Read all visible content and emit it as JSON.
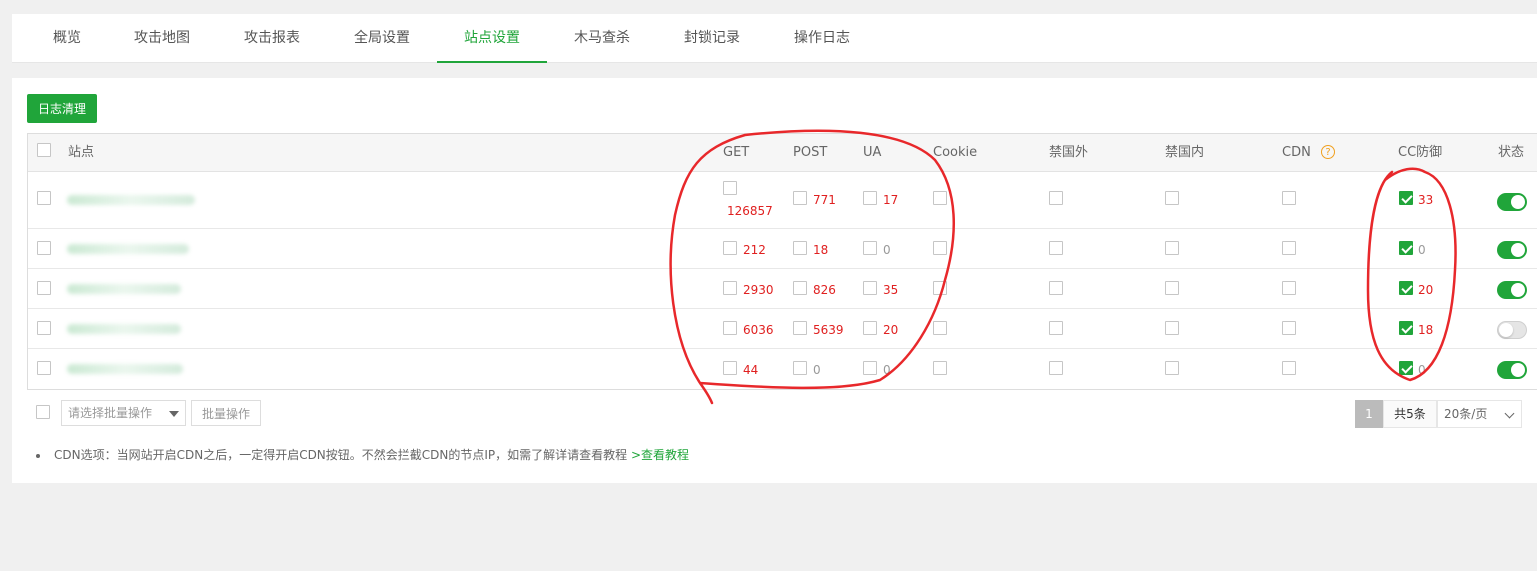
{
  "tabs": [
    {
      "label": "概览"
    },
    {
      "label": "攻击地图"
    },
    {
      "label": "攻击报表"
    },
    {
      "label": "全局设置"
    },
    {
      "label": "站点设置"
    },
    {
      "label": "木马查杀"
    },
    {
      "label": "封锁记录"
    },
    {
      "label": "操作日志"
    }
  ],
  "active_tab": "站点设置",
  "toolbar": {
    "clear_logs_label": "日志清理"
  },
  "table": {
    "headers": {
      "site": "站点",
      "get": "GET",
      "post": "POST",
      "ua": "UA",
      "cookie": "Cookie",
      "ban_foreign": "禁国外",
      "ban_domestic": "禁国内",
      "cdn": "CDN",
      "cdn_help": "?",
      "cc": "CC防御",
      "status": "状态"
    },
    "rows": [
      {
        "get": "126857",
        "post": "771",
        "ua": "17",
        "cc": "33",
        "status": "on"
      },
      {
        "get": "212",
        "post": "18",
        "ua": "0",
        "cc": "0",
        "status": "on"
      },
      {
        "get": "2930",
        "post": "826",
        "ua": "35",
        "cc": "20",
        "status": "on"
      },
      {
        "get": "6036",
        "post": "5639",
        "ua": "20",
        "cc": "18",
        "status": "off"
      },
      {
        "get": "44",
        "post": "0",
        "ua": "0",
        "cc": "0",
        "status": "on"
      }
    ]
  },
  "batch": {
    "select_placeholder": "请选择批量操作",
    "button_label": "批量操作"
  },
  "pagination": {
    "current_page": "1",
    "total": "共5条",
    "page_size": "20条/页"
  },
  "note": {
    "text": "CDN选项：当网站开启CDN之后，一定得开启CDN按钮。不然会拦截CDN的节点IP，如需了解详请查看教程",
    "link": ">查看教程"
  },
  "colors": {
    "accent": "#20a53a",
    "count_red": "#e02020",
    "annotation_red": "#e8282b"
  }
}
